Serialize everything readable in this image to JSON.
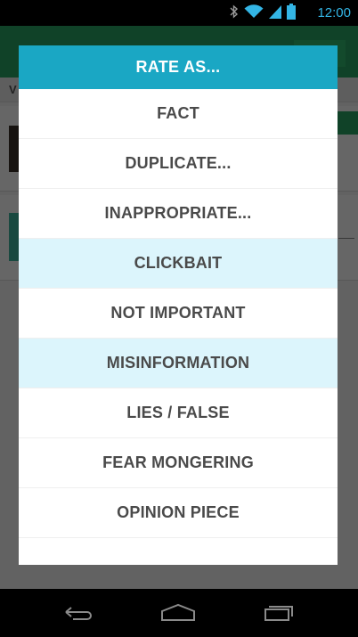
{
  "status_bar": {
    "time": "12:00",
    "icons": [
      "bluetooth-icon",
      "wifi-icon",
      "signal-icon",
      "battery-icon"
    ],
    "time_color": "#33b5e5"
  },
  "background_app": {
    "toolbar_color": "#2aa564",
    "toolbar_title": "",
    "subbar_label": "V"
  },
  "dialog": {
    "title": "RATE AS...",
    "header_color": "#1aa7c4",
    "highlight_color": "#dcf5fc",
    "options": [
      {
        "label": "FACT",
        "highlighted": false
      },
      {
        "label": "DUPLICATE...",
        "highlighted": false
      },
      {
        "label": "INAPPROPRIATE...",
        "highlighted": false
      },
      {
        "label": "CLICKBAIT",
        "highlighted": true
      },
      {
        "label": "NOT IMPORTANT",
        "highlighted": false
      },
      {
        "label": "MISINFORMATION",
        "highlighted": true
      },
      {
        "label": "LIES / FALSE",
        "highlighted": false
      },
      {
        "label": "FEAR MONGERING",
        "highlighted": false
      },
      {
        "label": "OPINION PIECE",
        "highlighted": false
      }
    ]
  },
  "nav_bar": {
    "buttons": [
      "back-icon",
      "home-icon",
      "recent-apps-icon"
    ]
  }
}
